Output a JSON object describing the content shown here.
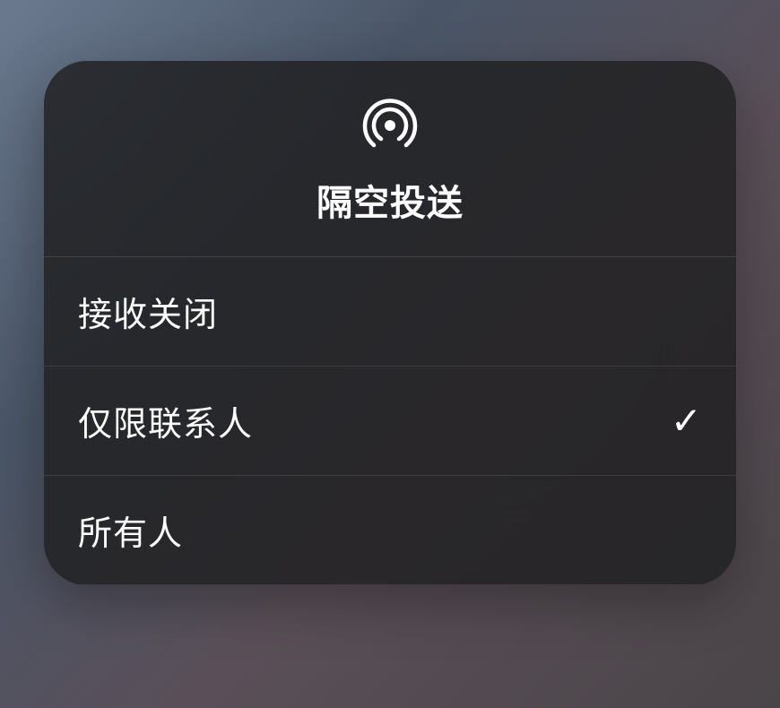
{
  "panel": {
    "title": "隔空投送",
    "options": [
      {
        "label": "接收关闭",
        "selected": false
      },
      {
        "label": "仅限联系人",
        "selected": true
      },
      {
        "label": "所有人",
        "selected": false
      }
    ]
  }
}
